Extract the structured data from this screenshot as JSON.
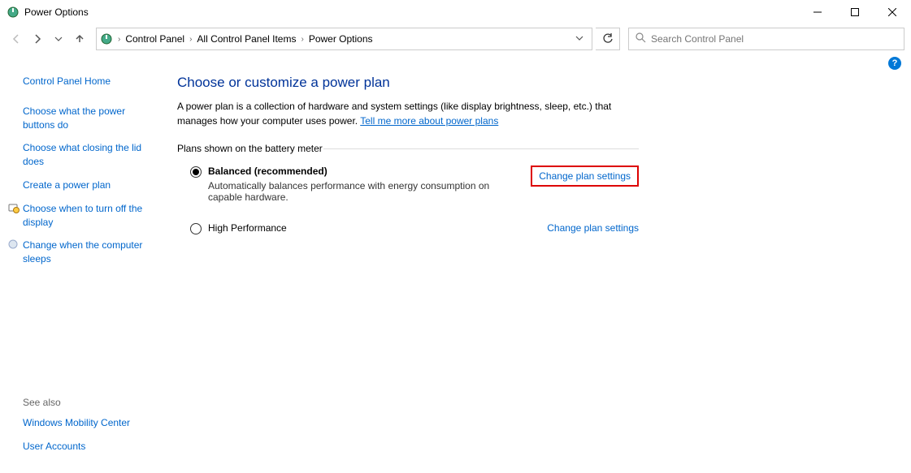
{
  "window": {
    "title": "Power Options"
  },
  "breadcrumb": {
    "items": [
      "Control Panel",
      "All Control Panel Items",
      "Power Options"
    ]
  },
  "search": {
    "placeholder": "Search Control Panel"
  },
  "sidebar": {
    "home": "Control Panel Home",
    "links": [
      "Choose what the power buttons do",
      "Choose what closing the lid does",
      "Create a power plan",
      "Choose when to turn off the display",
      "Change when the computer sleeps"
    ],
    "see_also_label": "See also",
    "see_also": [
      "Windows Mobility Center",
      "User Accounts"
    ]
  },
  "content": {
    "title": "Choose or customize a power plan",
    "desc_part1": "A power plan is a collection of hardware and system settings (like display brightness, sleep, etc.) that manages how your computer uses power. ",
    "desc_link": "Tell me more about power plans",
    "section_header": "Plans shown on the battery meter",
    "plans": [
      {
        "name": "Balanced (recommended)",
        "desc": "Automatically balances performance with energy consumption on capable hardware.",
        "selected": true,
        "highlighted": true
      },
      {
        "name": "High Performance",
        "desc": "",
        "selected": false,
        "highlighted": false
      }
    ],
    "change_link": "Change plan settings"
  }
}
